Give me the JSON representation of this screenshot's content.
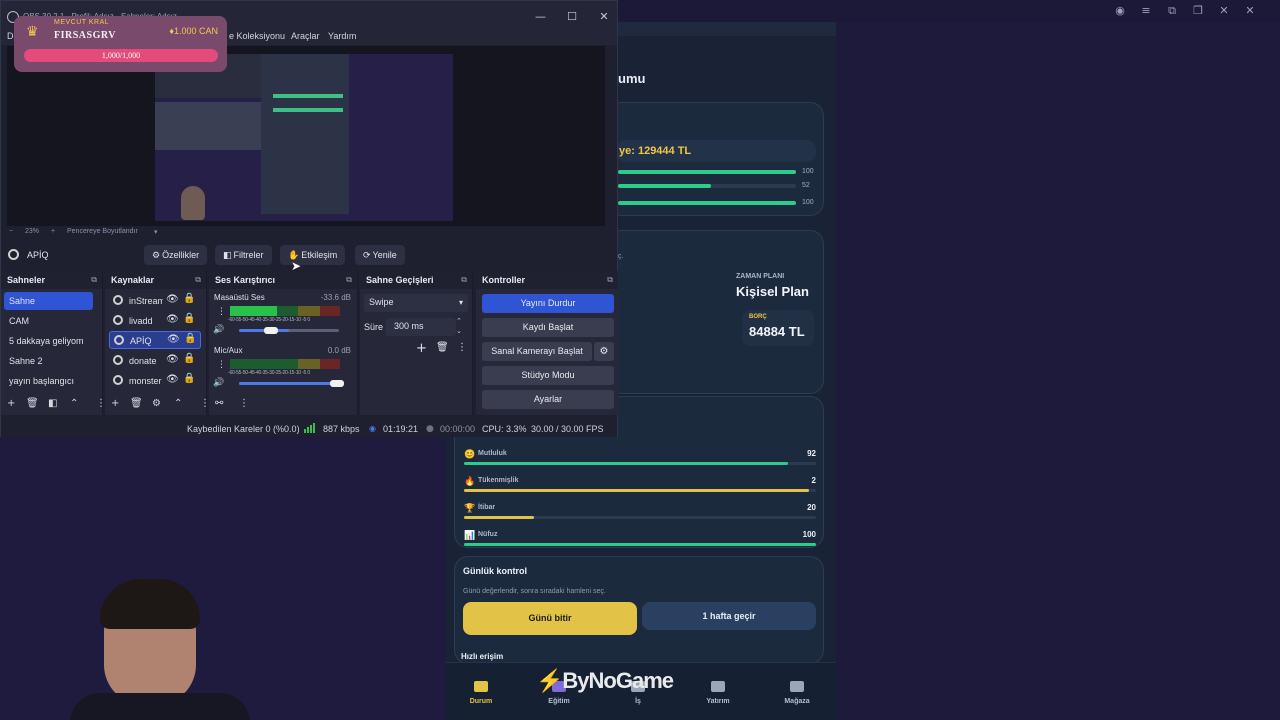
{
  "desktop": {
    "window_controls": [
      "◉",
      "≡",
      "⧉",
      "❐",
      "✕",
      "✕"
    ]
  },
  "game": {
    "title_fragment": "umu",
    "balance": "ye: 129444 TL",
    "mini_bars": [
      {
        "value": "100",
        "fraction": 1.0
      },
      {
        "value": "52",
        "fraction": 0.52
      },
      {
        "value": "100",
        "fraction": 1.0
      }
    ],
    "note_fragment": "ç.",
    "plan_label": "ZAMAN PLANI",
    "plan_name": "Kişisel Plan",
    "debt_label": "BORÇ",
    "debt_value": "84884 TL",
    "stats": [
      {
        "icon": "😊",
        "icon_name": "smile-icon",
        "name": "Mutluluk",
        "value": "92",
        "fraction": 0.92,
        "color": "#2ecc8b"
      },
      {
        "icon": "🔥",
        "icon_name": "fire-icon",
        "name": "Tükenmişlik",
        "value": "2",
        "fraction": 0.98,
        "color": "#e3c345"
      },
      {
        "icon": "🏆",
        "icon_name": "trophy-icon",
        "name": "İtibar",
        "value": "20",
        "fraction": 0.2,
        "color": "#e3c345"
      },
      {
        "icon": "📊",
        "icon_name": "chart-icon",
        "name": "Nüfuz",
        "value": "100",
        "fraction": 1.0,
        "color": "#2ecc8b"
      }
    ],
    "daily_title": "Günlük kontrol",
    "daily_sub": "Günü değerlendir, sonra sıradaki hamleni seç.",
    "end_day": "Günü bitir",
    "skip_week": "1 hafta geçir",
    "quick_title": "Hızlı erişim",
    "nav": [
      {
        "label": "Durum",
        "icon_name": "folder-icon",
        "color": "#e3c345"
      },
      {
        "label": "Eğitim",
        "icon_name": "book-icon",
        "color": "#7c6bd8"
      },
      {
        "label": "İş",
        "icon_name": "briefcase-icon",
        "color": "#9da6b8"
      },
      {
        "label": "Yatırım",
        "icon_name": "trend-icon",
        "color": "#9da6b8"
      },
      {
        "label": "Mağaza",
        "icon_name": "store-icon",
        "color": "#9da6b8"
      }
    ]
  },
  "watermark": {
    "pre": "",
    "brand": "ByNoGame"
  },
  "obs": {
    "title": "OBS 30.2.1 - Profil: Adsız - Sahneler: Adsız",
    "window_controls": [
      "—",
      "☐",
      "✕"
    ],
    "menu": [
      "Do",
      "e Koleksiyonu",
      "Araçlar",
      "Yardım"
    ],
    "zoom": {
      "minus": "−",
      "value": "23%",
      "plus": "+",
      "fit": "Pencereye Boyutlandır",
      "caret": "▾"
    },
    "selected_source": "APİQ",
    "toolbar": [
      {
        "glyph": "⚙",
        "label": "Özellikler",
        "icon_name": "gear-icon"
      },
      {
        "glyph": "◧",
        "label": "Filtreler",
        "icon_name": "filter-icon"
      },
      {
        "glyph": "✋",
        "label": "Etkileşim",
        "icon_name": "hand-icon"
      },
      {
        "glyph": "⟳",
        "label": "Yenile",
        "icon_name": "refresh-icon"
      }
    ],
    "scenes_title": "Sahneler",
    "scenes": [
      "Sahne",
      "CAM",
      "5 dakkaya geliyom",
      "Sahne 2",
      "yayın başlangıcı"
    ],
    "sources_title": "Kaynaklar",
    "sources": [
      "inStream",
      "livadd",
      "APİQ",
      "donate",
      "monster"
    ],
    "mixer_title": "Ses Karıştırıcı",
    "mixer": [
      {
        "name": "Masaüstü Ses",
        "db": "-33.6 dB",
        "level": 0.43,
        "volume": 0.5
      },
      {
        "name": "Mic/Aux",
        "db": "0.0 dB",
        "level": 0.0,
        "volume": 1.0
      }
    ],
    "ticks": "-60-55-50-45-40-35-30-25-20-15-10 -5 0",
    "transitions_title": "Sahne Geçişleri",
    "transition": "Swipe",
    "duration_label": "Süre",
    "duration": "300 ms",
    "controls_title": "Kontroller",
    "controls": [
      "Yayını Durdur",
      "Kaydı Başlat",
      "Sanal Kamerayı Başlat",
      "Stüdyo Modu",
      "Ayarlar"
    ],
    "status": {
      "dropped": "Kaybedilen Kareler 0 (%0.0)",
      "bitrate": "887 kbps",
      "live_time": "01:19:21",
      "rec_time": "00:00:00",
      "cpu": "CPU: 3.3%",
      "fps": "30.00 / 30.00 FPS"
    }
  },
  "king": {
    "label": "MEVCUT KRAL",
    "name": "FIRSASGRV",
    "can": "♦1.000 CAN",
    "hp": "1,000/1,000"
  }
}
